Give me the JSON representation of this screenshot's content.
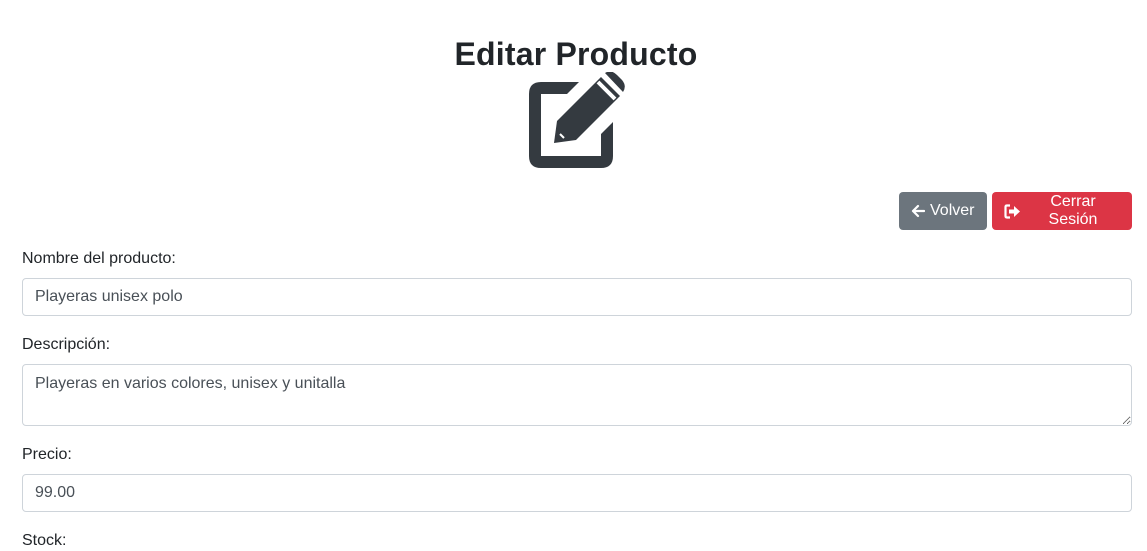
{
  "header": {
    "title": "Editar Producto",
    "icon": "edit-icon"
  },
  "toolbar": {
    "back_label": "Volver",
    "back_icon": "arrow-left-icon",
    "logout_label": "Cerrar Sesión",
    "logout_icon": "sign-out-icon"
  },
  "form": {
    "name": {
      "label": "Nombre del producto:",
      "value": "Playeras unisex polo"
    },
    "description": {
      "label": "Descripción:",
      "value": "Playeras en varios colores, unisex y unitalla"
    },
    "price": {
      "label": "Precio:",
      "value": "99.00"
    },
    "stock": {
      "label": "Stock:"
    }
  },
  "colors": {
    "secondary": "#6c757d",
    "danger": "#dc3545",
    "icon": "#343a40",
    "border": "#ced4da"
  }
}
